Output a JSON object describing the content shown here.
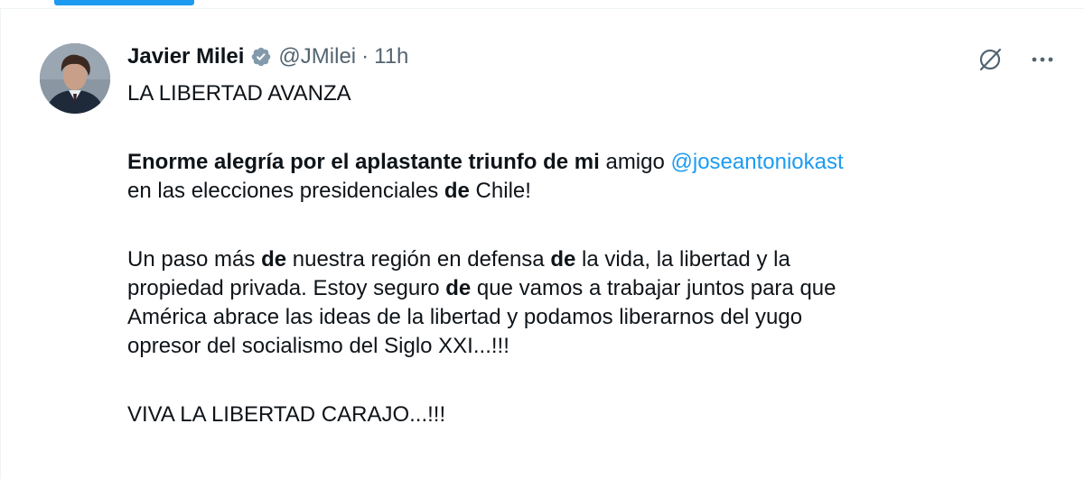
{
  "tweet": {
    "author_name": "Javier Milei",
    "handle": "@JMilei",
    "separator": "·",
    "time": "11h",
    "line1": "LA LIBERTAD AVANZA",
    "p2": {
      "bold1": "Enorme alegría por el aplastante triunfo de mi",
      "text1": " amigo ",
      "mention": "@joseantoniokast",
      "text2": "en las elecciones presidenciales ",
      "bold2": "de",
      "text3": " Chile!"
    },
    "p3": {
      "t1": "Un paso más ",
      "b1": "de",
      "t2": " nuestra región en defensa ",
      "b2": "de",
      "t3": " la vida, la libertad y la",
      "t4": "propiedad privada. Estoy seguro ",
      "b3": "de",
      "t5": " que vamos a trabajar juntos para que",
      "t6": "América abrace las ideas de la libertad y podamos liberarnos del yugo",
      "t7": "opresor del socialismo del Siglo XXI...!!!"
    },
    "closing": "VIVA LA LIBERTAD CARAJO...!!!"
  },
  "icons": {
    "verified": "verified-badge-icon",
    "grok": "grok-icon",
    "more": "more-icon"
  },
  "colors": {
    "accent": "#1d9bf0",
    "text": "#0f1419",
    "secondary": "#536471",
    "verified_badge": "#829aab"
  }
}
